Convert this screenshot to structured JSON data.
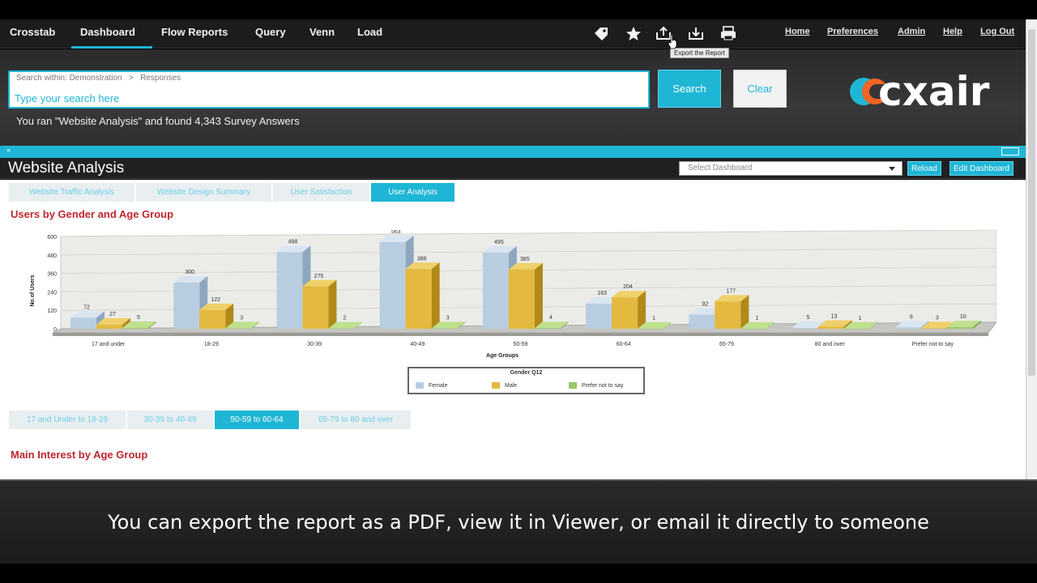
{
  "nav": {
    "items": [
      "Crosstab",
      "Dashboard",
      "Flow Reports",
      "Query",
      "Venn",
      "Load"
    ],
    "active": "Dashboard",
    "icons": [
      "tag-icon",
      "star-icon",
      "export-icon",
      "download-icon",
      "print-icon"
    ],
    "util_links": [
      "Home",
      "Preferences",
      "Admin",
      "Help",
      "Log Out"
    ],
    "tooltip": "Export the Report"
  },
  "search": {
    "scope": "Search within: Demonstration   >   Responses",
    "placeholder": "Type your search here",
    "search_label": "Search",
    "clear_label": "Clear",
    "result": "You ran \"Website Analysis\" and found 4,343 Survey Answers"
  },
  "logo": {
    "text": "cxair"
  },
  "dashboard": {
    "title": "Website Analysis",
    "select_placeholder": "Select Dashboard",
    "reload_label": "Reload",
    "edit_label": "Edit Dashboard",
    "tabs": [
      "Website Traffic Analysis",
      "Website Design Summary",
      "User Satisfaction",
      "User Analysis"
    ],
    "active_tab": "User Analysis"
  },
  "section1": {
    "title": "Users by Gender and Age Group"
  },
  "chart_data": {
    "type": "bar",
    "xlabel": "Age Groups",
    "ylabel": "No of Users",
    "ylim": [
      0,
      600
    ],
    "yticks": [
      0,
      120,
      240,
      360,
      480,
      600
    ],
    "categories": [
      "17 and under",
      "18-29",
      "30-39",
      "40-49",
      "50-59",
      "60-64",
      "65-79",
      "80 and over",
      "Prefer not to say"
    ],
    "series": [
      {
        "name": "Female",
        "values": [
          72,
          300,
          498,
          563,
          495,
          163,
          92,
          5,
          8
        ],
        "color": "#b9cde0"
      },
      {
        "name": "Male",
        "values": [
          27,
          122,
          275,
          388,
          385,
          204,
          177,
          13,
          3
        ],
        "color": "#e3b93f"
      },
      {
        "name": "Prefer not to say",
        "values": [
          5,
          3,
          2,
          3,
          4,
          1,
          1,
          1,
          10
        ],
        "color": "#9cc76a"
      }
    ],
    "legend_title": "Gender Q12",
    "legend_position": "bottom"
  },
  "age_tabs": {
    "items": [
      "17 and Under to 18-29",
      "30-39 to 40-49",
      "50-59 to 60-64",
      "65-79 to 80 and over"
    ],
    "active": "50-59 to 60-64"
  },
  "section2": {
    "title": "Main Interest by Age Group"
  },
  "caption": "You can export the report as a PDF, view it in Viewer, or email it directly to someone"
}
